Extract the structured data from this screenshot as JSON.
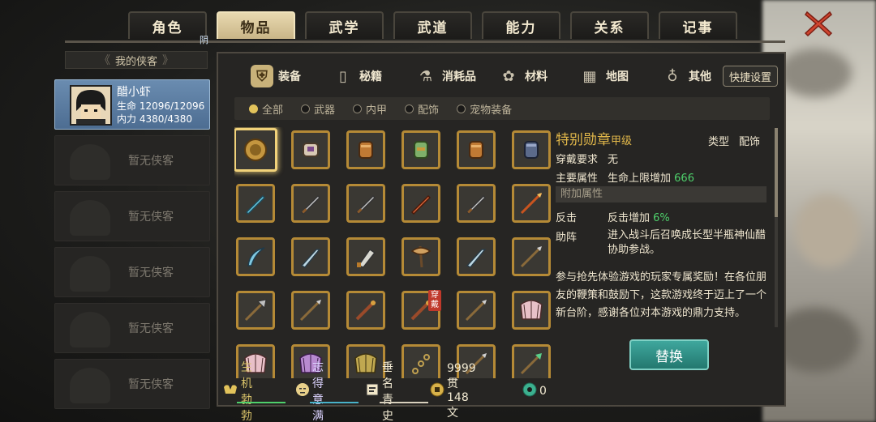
{
  "top_tabs": [
    "角色",
    "物品",
    "武学",
    "武道",
    "能力",
    "关系",
    "记事"
  ],
  "active_top_tab": 1,
  "roster": {
    "title": "我的侠客",
    "active": {
      "name": "醋小虾",
      "hp_label": "生命",
      "hp_value": "12096/12096",
      "mp_label": "内力",
      "mp_value": "4380/4380",
      "badge": "阴"
    },
    "empty_label": "暂无侠客"
  },
  "sub_tabs": [
    {
      "label": "装备",
      "icon": "armor-icon"
    },
    {
      "label": "秘籍",
      "icon": "book-icon"
    },
    {
      "label": "消耗品",
      "icon": "potion-icon"
    },
    {
      "label": "材料",
      "icon": "herb-icon"
    },
    {
      "label": "地图",
      "icon": "map-icon"
    },
    {
      "label": "其他",
      "icon": "lamp-icon"
    }
  ],
  "quick_settings": "快捷设置",
  "filters": [
    {
      "label": "全部",
      "on": true
    },
    {
      "label": "武器",
      "on": false
    },
    {
      "label": "内甲",
      "on": false
    },
    {
      "label": "配饰",
      "on": false
    },
    {
      "label": "宠物装备",
      "on": false
    }
  ],
  "items": [
    {
      "icon": "medal-icon",
      "selected": true
    },
    {
      "icon": "bracer-icon"
    },
    {
      "icon": "gauntlet-icon"
    },
    {
      "icon": "jade-glove-icon"
    },
    {
      "icon": "gauntlet-icon"
    },
    {
      "icon": "steel-glove-icon"
    },
    {
      "icon": "blue-sword-icon"
    },
    {
      "icon": "sword-icon"
    },
    {
      "icon": "sword-icon"
    },
    {
      "icon": "red-sword-icon"
    },
    {
      "icon": "sword-icon"
    },
    {
      "icon": "red-spear-icon"
    },
    {
      "icon": "curved-blade-icon"
    },
    {
      "icon": "saber-icon"
    },
    {
      "icon": "broad-blade-icon"
    },
    {
      "icon": "axe-icon"
    },
    {
      "icon": "saber-icon"
    },
    {
      "icon": "spear-icon"
    },
    {
      "icon": "halberd-icon"
    },
    {
      "icon": "spear-icon"
    },
    {
      "icon": "staff-icon"
    },
    {
      "icon": "staff-icon",
      "worn": "穿戴"
    },
    {
      "icon": "spear-icon"
    },
    {
      "icon": "fan-icon"
    },
    {
      "icon": "fan-icon"
    },
    {
      "icon": "purple-fan-icon"
    },
    {
      "icon": "gold-fan-icon"
    },
    {
      "icon": "chain-whip-icon"
    },
    {
      "icon": "spear-icon"
    },
    {
      "icon": "jade-spear-icon"
    }
  ],
  "detail": {
    "name": "特别勋章",
    "grade": "甲级",
    "type_label": "类型",
    "type_value": "配饰",
    "req_label": "穿戴要求",
    "req_value": "无",
    "main_label": "主要属性",
    "main_text": "生命上限增加",
    "main_num": "666",
    "extra_header": "附加属性",
    "attr1_label": "反击",
    "attr1_text": "反击增加",
    "attr1_num": "6%",
    "attr2_label": "助阵",
    "attr2_text": "进入战斗后召唤成长型半瓶神仙醋协助参战。",
    "description": "参与抢先体验游戏的玩家专属奖励！在各位朋友的鞭策和鼓励下，这款游戏终于迈上了一个新台阶，感谢各位对本游戏的鼎力支持。"
  },
  "replace_button": "替换",
  "status": {
    "s1": "生机勃勃",
    "s2": "志得意满",
    "s3": "垂名青史",
    "money": "9999贯148文",
    "gems": "0"
  },
  "colors": {
    "gold": "#e2b84a",
    "green": "#4ed06b",
    "teal_button": "#2f8f85",
    "slot_border": "#b58a36"
  }
}
